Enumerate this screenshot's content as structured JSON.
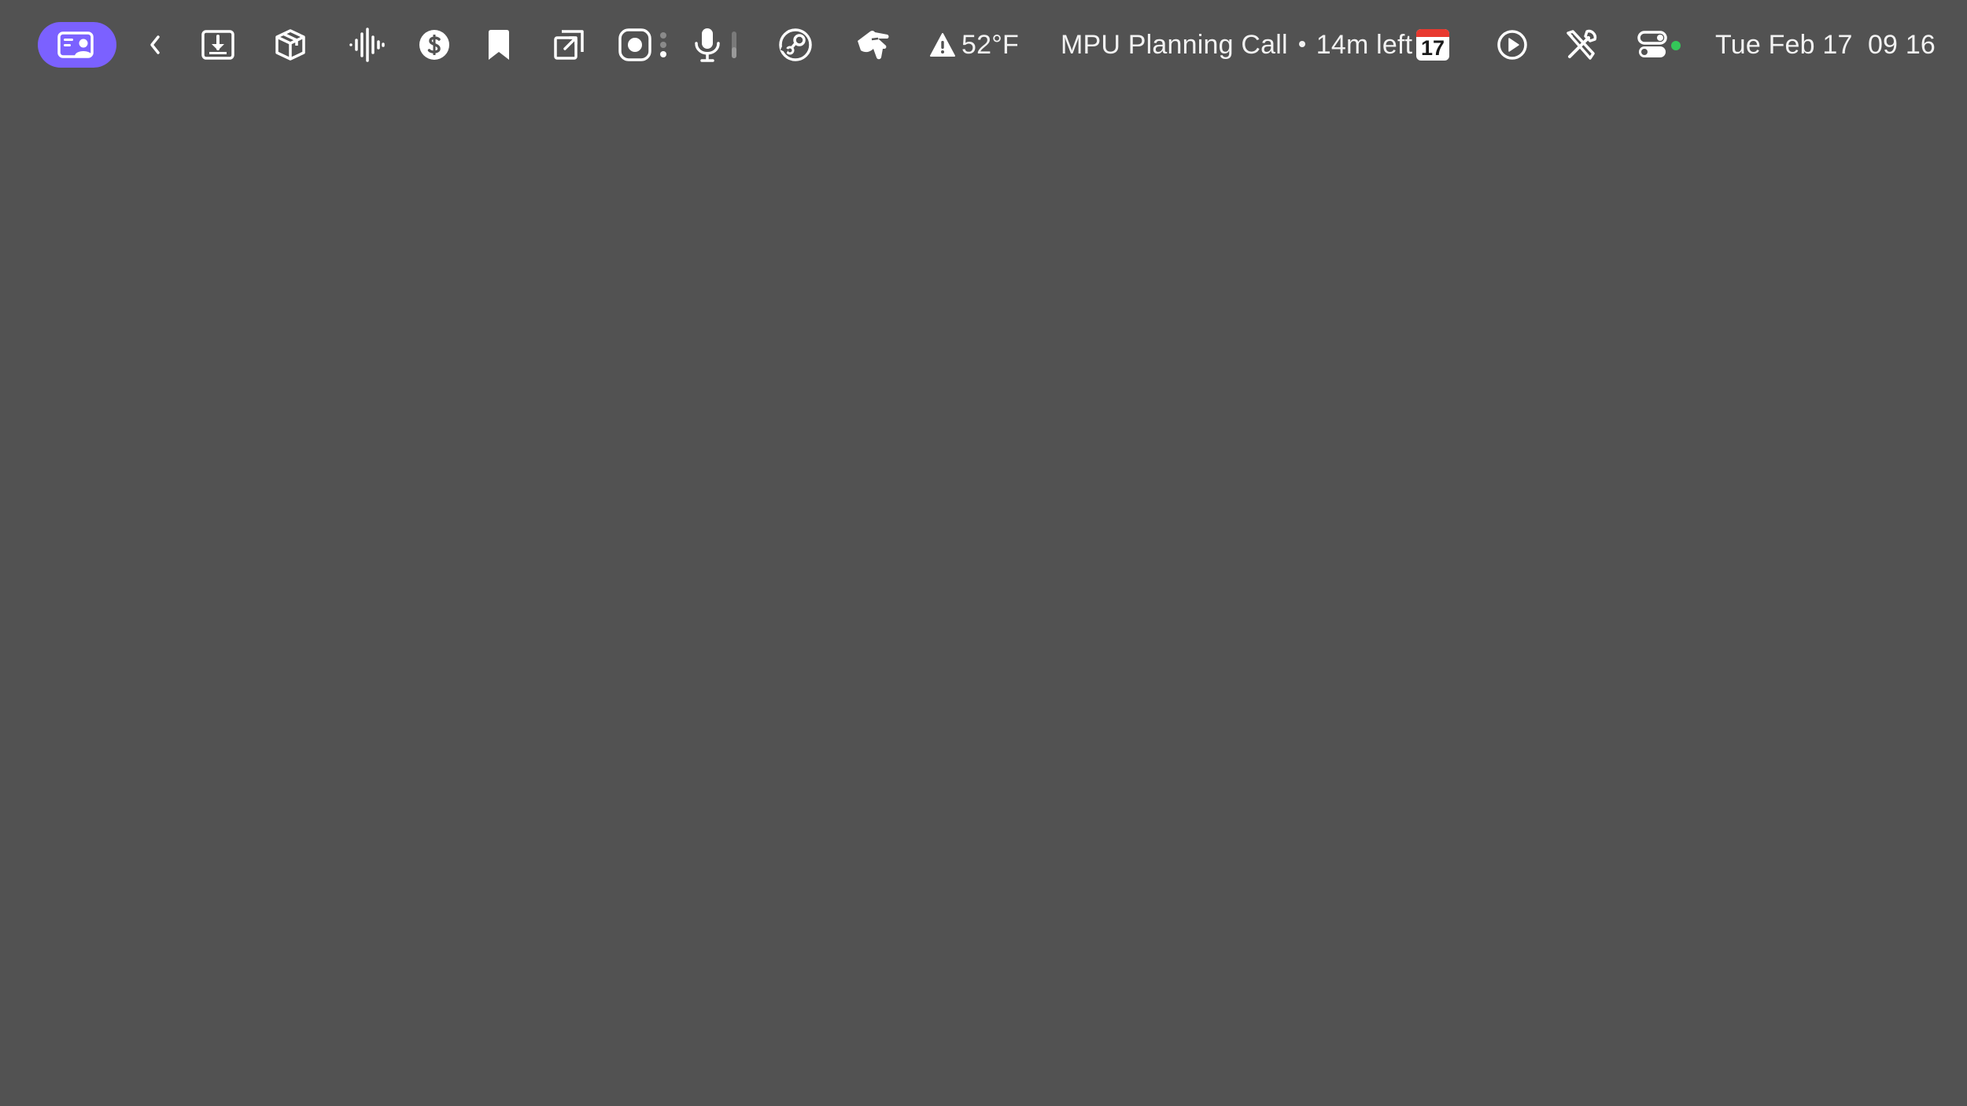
{
  "menubar": {
    "accent_color": "#7b61ff",
    "weather": {
      "icon": "warning-triangle-icon",
      "temperature": "52°F"
    },
    "meeting": {
      "title": "MPU Planning Call",
      "time_left": "14m left"
    },
    "calendar": {
      "icon": "calendar-icon",
      "day": "17",
      "header_color": "#e8392f"
    },
    "control_center": {
      "status_color": "#34c759"
    },
    "clock": {
      "day": "Tue",
      "date": "Feb 17",
      "time": "09 16"
    }
  }
}
